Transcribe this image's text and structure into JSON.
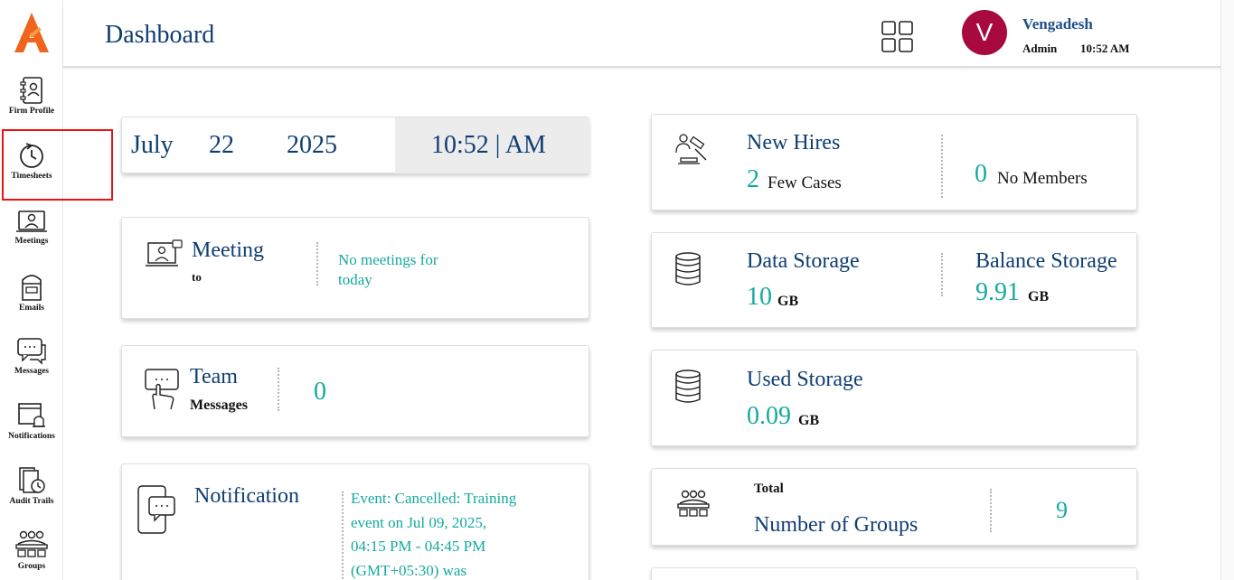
{
  "sidebar": {
    "items": [
      {
        "label": "Firm Profile",
        "icon": "firm-profile-icon"
      },
      {
        "label": "Timesheets",
        "icon": "timesheets-icon"
      },
      {
        "label": "Meetings",
        "icon": "meetings-icon"
      },
      {
        "label": "Emails",
        "icon": "emails-icon"
      },
      {
        "label": "Messages",
        "icon": "messages-icon"
      },
      {
        "label": "Notifications",
        "icon": "notifications-icon"
      },
      {
        "label": "Audit Trails",
        "icon": "audit-trails-icon"
      },
      {
        "label": "Groups",
        "icon": "groups-icon"
      }
    ]
  },
  "header": {
    "title": "Dashboard",
    "user": {
      "initial": "V",
      "name": "Vengadesh",
      "role": "Admin",
      "time": "10:52 AM"
    }
  },
  "colors": {
    "primary": "#0f3e73",
    "accent": "#14a99f",
    "avatar": "#a8093e",
    "highlight": "#ee1111"
  },
  "date_card": {
    "month": "July",
    "day": "22",
    "year": "2025",
    "time": "10:52 | AM"
  },
  "meeting_card": {
    "title": "Meeting",
    "subtitle": "to",
    "status": "No meetings for today"
  },
  "team_card": {
    "title": "Team",
    "subtitle": "Messages",
    "count": "0"
  },
  "notification_card": {
    "title": "Notification",
    "lines": [
      "Event: Cancelled: Training",
      "event on Jul 09, 2025,",
      "04:15 PM - 04:45 PM",
      "(GMT+05:30) was"
    ]
  },
  "new_hires_card": {
    "title": "New Hires",
    "count": "2",
    "count_label": "Few Cases",
    "members_count": "0",
    "members_label": "No Members"
  },
  "data_storage_card": {
    "title": "Data Storage",
    "value": "10",
    "unit": "GB",
    "balance_title": "Balance Storage",
    "balance_value": "9.91",
    "balance_unit": "GB"
  },
  "used_storage_card": {
    "title": "Used Storage",
    "value": "0.09",
    "unit": "GB"
  },
  "groups_card": {
    "label_small": "Total",
    "title": "Number of Groups",
    "count": "9"
  }
}
